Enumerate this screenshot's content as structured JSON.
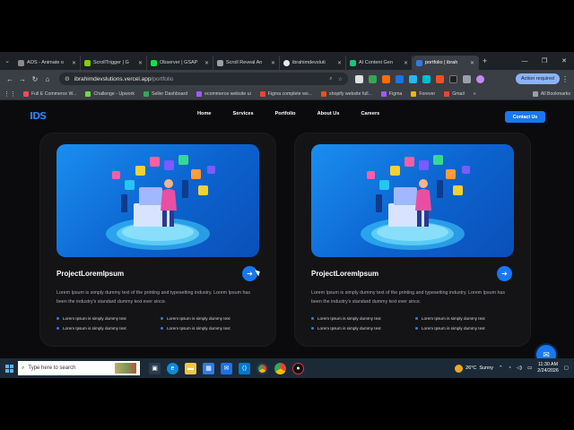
{
  "browser": {
    "tabs": [
      {
        "title": "AOS - Animate o",
        "color": "#8a8a8a"
      },
      {
        "title": "ScrollTrigger | G",
        "color": "#88ce02"
      },
      {
        "title": "Observer | GSAP",
        "color": "#0ae448"
      },
      {
        "title": "Scroll Reveal An",
        "color": "#9aa0a6"
      },
      {
        "title": "ibrahimdevsluti",
        "color": "#e8e8e8"
      },
      {
        "title": "AI Content Gen",
        "color": "#19c37d"
      },
      {
        "title": "portfolio | ibrah",
        "color": "#2f7be8",
        "active": true
      }
    ],
    "url_host": "ibrahimdevslutions.vercel.app",
    "url_path": "/portfolio",
    "action_required": "Action required",
    "bookmarks": [
      {
        "label": "Full E Commerce W...",
        "color": "#ef4a5b"
      },
      {
        "label": "Challenge - Upwork",
        "color": "#6fda44"
      },
      {
        "label": "Seller Dashboard",
        "color": "#34a853"
      },
      {
        "label": "ecommerce website ui",
        "color": "#a259ff"
      },
      {
        "label": "Figma complete wo...",
        "color": "#ea4335"
      },
      {
        "label": "shopify website full...",
        "color": "#f24e1e"
      },
      {
        "label": "Figma",
        "color": "#a259ff"
      },
      {
        "label": "Forever",
        "color": "#f4b400"
      },
      {
        "label": "Gmail",
        "color": "#ea4335"
      }
    ],
    "all_bookmarks": "All Bookmarks"
  },
  "site": {
    "logo": "IDS",
    "nav": [
      "Home",
      "Services",
      "Portfolio",
      "About Us",
      "Careers"
    ],
    "contact_label": "Contact Us",
    "cards": [
      {
        "title": "ProjectLoremIpsum",
        "description": "Lorem Ipsum is simply dummy text of the printing and typesetting industry. Lorem Ipsum has been the industry's standard dummy text ever since.",
        "bullets": [
          "Lorem Ipsum is simply dummy text",
          "Lorem Ipsum is simply dummy text",
          "Lorem Ipsum is simply dummy text",
          "Lorem Ipsum is simply dummy text"
        ]
      },
      {
        "title": "ProjectLoremIpsum",
        "description": "Lorem Ipsum is simply dummy text of the printing and typesetting industry. Lorem Ipsum has been the industry's standard dummy text ever since.",
        "bullets": [
          "Lorem Ipsum is simply dummy text",
          "Lorem Ipsum is simply dummy text",
          "Lorem Ipsum is simply dummy text",
          "Lorem Ipsum is simply dummy text"
        ]
      }
    ]
  },
  "taskbar": {
    "search_placeholder": "Type here to search",
    "temperature": "26°C",
    "weather": "Sunny",
    "time": "11:30 AM",
    "date": "2/24/2026"
  }
}
